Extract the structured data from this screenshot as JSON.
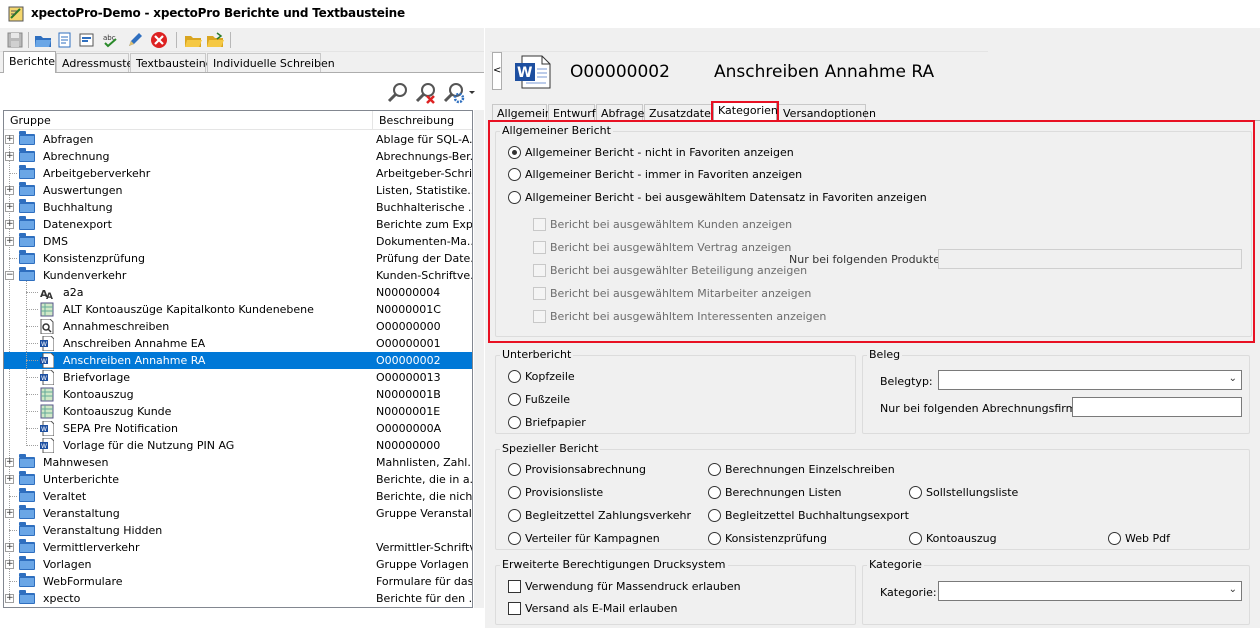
{
  "window": {
    "title": "xpectoPro-Demo - xpectoPro Berichte und Textbausteine"
  },
  "toolbar": {
    "icons": [
      "save-icon",
      "open-folder-icon",
      "export-icon",
      "import-icon",
      "spellcheck-icon",
      "edit-icon",
      "delete-icon",
      "folder-open-icon",
      "folder-open-2-icon"
    ]
  },
  "left_tabs": [
    "Berichte",
    "Adressmuster",
    "Textbausteine",
    "Individuelle Schreiben"
  ],
  "tree": {
    "header_group": "Gruppe",
    "header_desc": "Beschreibung",
    "rows": [
      {
        "label": "Abfragen",
        "desc": "Ablage für SQL-A..."
      },
      {
        "label": "Abrechnung",
        "desc": "Abrechnungs-Ber..."
      },
      {
        "label": "Arbeitgeberverkehr",
        "desc": "Arbeitgeber-Schri..."
      },
      {
        "label": "Auswertungen",
        "desc": "Listen, Statistike..."
      },
      {
        "label": "Buchhaltung",
        "desc": "Buchhalterische ..."
      },
      {
        "label": "Datenexport",
        "desc": "Berichte zum Exp..."
      },
      {
        "label": "DMS",
        "desc": "Dokumenten-Ma..."
      },
      {
        "label": "Konsistenzprüfung",
        "desc": "Prüfung der Date..."
      },
      {
        "label": "Kundenverkehr",
        "desc": "Kunden-Schriftve..."
      },
      {
        "label": "a2a",
        "desc": "N00000004"
      },
      {
        "label": "ALT Kontoauszüge Kapitalkonto Kundenebene",
        "desc": "N0000001C"
      },
      {
        "label": "Annahmeschreiben",
        "desc": "O00000000"
      },
      {
        "label": "Anschreiben Annahme EA",
        "desc": "O00000001"
      },
      {
        "label": "Anschreiben Annahme RA",
        "desc": "O00000002"
      },
      {
        "label": "Briefvorlage",
        "desc": "O00000013"
      },
      {
        "label": "Kontoauszug",
        "desc": "N0000001B"
      },
      {
        "label": "Kontoauszug Kunde",
        "desc": "N0000001E"
      },
      {
        "label": "SEPA Pre Notification",
        "desc": "O0000000A"
      },
      {
        "label": "Vorlage für die Nutzung PIN AG",
        "desc": "N00000000"
      },
      {
        "label": "Mahnwesen",
        "desc": "Mahnlisten, Zahl..."
      },
      {
        "label": "Unterberichte",
        "desc": "Berichte, die in a..."
      },
      {
        "label": "Veraltet",
        "desc": "Berichte, die nich..."
      },
      {
        "label": "Veranstaltung",
        "desc": "Gruppe Veranstal..."
      },
      {
        "label": "Veranstaltung Hidden",
        "desc": ""
      },
      {
        "label": "Vermittlerverkehr",
        "desc": "Vermittler-Schriftv..."
      },
      {
        "label": "Vorlagen",
        "desc": "Gruppe Vorlagen"
      },
      {
        "label": "WebFormulare",
        "desc": "Formulare für das..."
      },
      {
        "label": "xpecto",
        "desc": "Berichte für den ..."
      }
    ]
  },
  "report": {
    "code": "O00000002",
    "title": "Anschreiben Annahme RA"
  },
  "right_tabs": [
    "Allgemein",
    "Entwurf",
    "Abfrage",
    "Zusatzdaten",
    "Kategorien",
    "Versandoptionen"
  ],
  "allgemein": {
    "title": "Allgemeiner Bericht",
    "opt1": "Allgemeiner Bericht - nicht in Favoriten anzeigen",
    "opt2": "Allgemeiner Bericht - immer in Favoriten anzeigen",
    "opt3": "Allgemeiner Bericht - bei ausgewähltem Datensatz in Favoriten anzeigen",
    "chk1": "Bericht bei ausgewähltem Kunden anzeigen",
    "chk2": "Bericht bei ausgewähltem Vertrag anzeigen",
    "chk3": "Bericht bei ausgewählter Beteiligung anzeigen",
    "chk4": "Bericht bei ausgewähltem Mitarbeiter anzeigen",
    "chk5": "Bericht bei ausgewähltem Interessenten anzeigen",
    "products_label": "Nur bei folgenden Produkten:",
    "products_value": ""
  },
  "unterbericht": {
    "title": "Unterbericht",
    "opt1": "Kopfzeile",
    "opt2": "Fußzeile",
    "opt3": "Briefpapier"
  },
  "beleg": {
    "title": "Beleg",
    "belegtyp_label": "Belegtyp:",
    "belegtyp_value": "",
    "firm_label": "Nur bei folgenden Abrechnungsfirmen:",
    "firm_value": ""
  },
  "spezial": {
    "title": "Spezieller Bericht",
    "o1": "Provisionsabrechnung",
    "o2": "Berechnungen Einzelschreiben",
    "o3": "Provisionsliste",
    "o4": "Berechnungen Listen",
    "o5": "Sollstellungsliste",
    "o6": "Begleitzettel Zahlungsverkehr",
    "o7": "Begleitzettel Buchhaltungsexport",
    "o8": "Verteiler für Kampagnen",
    "o9": "Konsistenzprüfung",
    "o10": "Kontoauszug",
    "o11": "Web Pdf"
  },
  "rechte": {
    "title": "Erweiterte Berechtigungen Drucksystem",
    "c1": "Verwendung für Massendruck erlauben",
    "c2": "Versand als E-Mail erlauben"
  },
  "kategorie": {
    "title": "Kategorie",
    "label": "Kategorie:",
    "value": ""
  },
  "colors": {
    "selection": "#0078d7",
    "highlight": "#e81123",
    "folder": "#2f6fbf"
  }
}
